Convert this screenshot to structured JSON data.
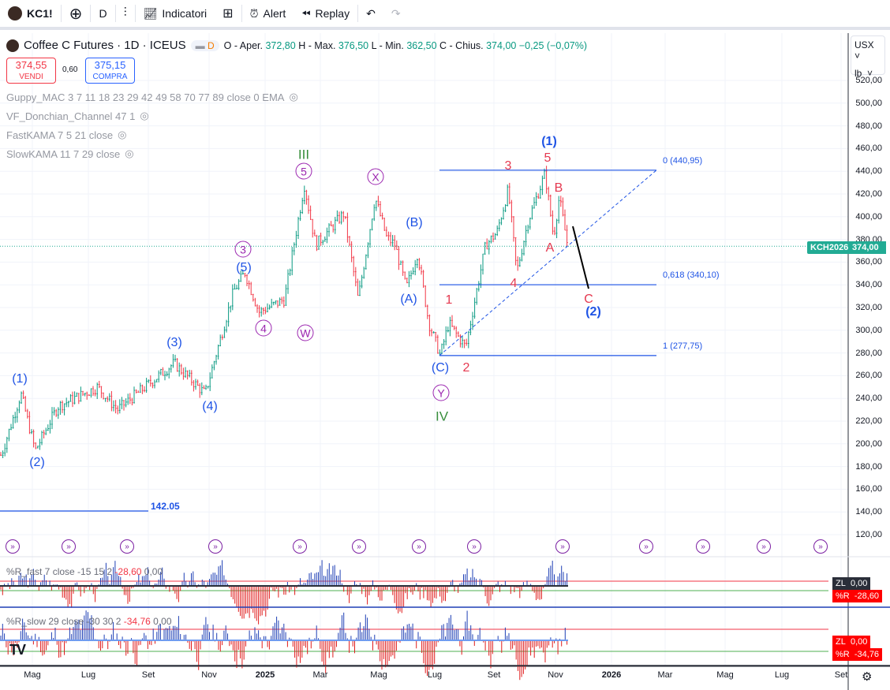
{
  "toolbar": {
    "symbol": "KC1!",
    "interval": "D",
    "indicators": "Indicatori",
    "alert": "Alert",
    "replay": "Replay"
  },
  "legend": {
    "title": "Coffee C Futures · 1D · ICEUS",
    "badge": "D",
    "o_label": "O - Aper.",
    "o": "372,80",
    "h_label": "H - Max.",
    "h": "376,50",
    "l_label": "L - Min.",
    "l": "362,50",
    "c_label": "C - Chius.",
    "c": "374,00",
    "change": "−0,25 (−0,07%)",
    "sell_price": "374,55",
    "sell_label": "VENDI",
    "spread": "0,60",
    "buy_price": "375,15",
    "buy_label": "COMPRA",
    "indicators": [
      "Guppy_MAC 3 7 11 18 23 29 42 49 58 70 77 89 close 0 EMA",
      "VF_Donchian_Channel 47 1",
      "FastKAMA 7 5 21 close",
      "SlowKAMA 11 7 29 close"
    ]
  },
  "axis": {
    "currency": "USX",
    "unit": "lb",
    "prices": [
      "520,00",
      "500,00",
      "480,00",
      "460,00",
      "440,00",
      "420,00",
      "400,00",
      "380,00",
      "360,00",
      "340,00",
      "320,00",
      "300,00",
      "280,00",
      "260,00",
      "240,00",
      "220,00",
      "200,00",
      "180,00",
      "160,00",
      "140,00",
      "120,00"
    ],
    "last_ticker": "KCH2026",
    "last_price": "374,00"
  },
  "time_axis": [
    "Mag",
    "Lug",
    "Set",
    "Nov",
    "2025",
    "Mar",
    "Mag",
    "Lug",
    "Set",
    "Nov",
    "2026",
    "Mar",
    "Mag",
    "Lug",
    "Set"
  ],
  "fib": {
    "level0": "0 (440,95)",
    "level618": "0,618 (340,10)",
    "level1": "1 (277,75)",
    "hline": "142.05"
  },
  "waves": [
    "(1)",
    "(2)",
    "(3)",
    "(4)",
    "(5)",
    "3",
    "4",
    "W",
    "5",
    "III",
    "X",
    "(B)",
    "(A)",
    "(C)",
    "Y",
    "IV",
    "1",
    "2",
    "3",
    "4",
    "5",
    "(1)",
    "B",
    "A",
    "C",
    "(2)"
  ],
  "osc1": {
    "title": "%R_fast 7 close -15 15 2",
    "v1": "-28,60",
    "v2": "0,00",
    "zl": "ZL",
    "zl_val": "0,00",
    "r": "%R",
    "r_val": "-28,60"
  },
  "osc2": {
    "title": "%R_slow 29 close -30 30 2",
    "v1": "-34,76",
    "v2": "0,00",
    "zl": "ZL",
    "zl_val": "0,00",
    "r": "%R",
    "r_val": "-34,76"
  },
  "chart_data": {
    "type": "candlestick",
    "ylim": [
      110,
      530
    ],
    "price_pivots_months_from_may2024": [
      [
        -1.1,
        190
      ],
      [
        -0.4,
        244
      ],
      [
        0.1,
        194
      ],
      [
        0.9,
        233
      ],
      [
        2.3,
        250
      ],
      [
        3.0,
        230
      ],
      [
        5.0,
        271
      ],
      [
        6.1,
        244
      ],
      [
        7.1,
        334
      ],
      [
        7.5,
        351
      ],
      [
        8.0,
        316
      ],
      [
        8.9,
        327
      ],
      [
        9.6,
        428
      ],
      [
        10.0,
        375
      ],
      [
        11.0,
        403
      ],
      [
        11.5,
        327
      ],
      [
        12.1,
        417
      ],
      [
        12.5,
        382
      ],
      [
        12.8,
        375
      ],
      [
        13.2,
        337
      ],
      [
        13.6,
        368
      ],
      [
        14.0,
        306
      ],
      [
        14.4,
        278
      ],
      [
        14.7,
        306
      ],
      [
        15.3,
        285
      ],
      [
        16.0,
        375
      ],
      [
        16.4,
        386
      ],
      [
        16.8,
        424
      ],
      [
        17.1,
        351
      ],
      [
        17.5,
        396
      ],
      [
        18.1,
        438
      ],
      [
        18.4,
        382
      ],
      [
        18.6,
        417
      ],
      [
        18.9,
        374
      ]
    ]
  },
  "colors": {
    "up": "#089981",
    "down": "#f23645",
    "wave_blue": "#1e53e5",
    "wave_red": "#e53950",
    "wave_purple": "#9c27b0",
    "wave_green": "#388e3c"
  }
}
